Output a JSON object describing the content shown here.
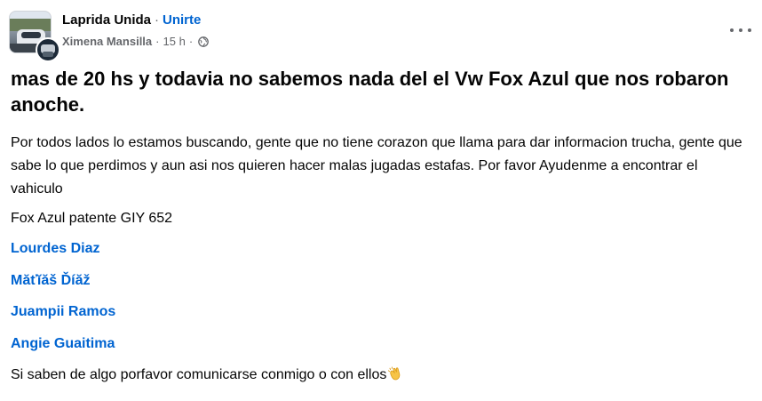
{
  "header": {
    "group_name": "Laprida Unida",
    "separator": "·",
    "join_label": "Unirte",
    "author": "Ximena Mansilla",
    "time_separator": "·",
    "timestamp": "15 h",
    "audience_icon": "globe-icon",
    "more_icon": "more-options-icon"
  },
  "post": {
    "title": "mas de 20 hs y todavia no sabemos nada del el Vw Fox Azul que nos robaron anoche.",
    "paragraph1": "Por todos lados lo estamos buscando, gente que no tiene corazon que llama para dar informacion trucha, gente que sabe lo que perdimos y aun asi nos quieren hacer malas jugadas estafas. Por favor Ayudenme a encontrar el vahiculo",
    "paragraph2": "Fox Azul patente GIY 652",
    "mentions": [
      "Lourdes Diaz",
      "Măťĭăš Ďíăž",
      "Juampii Ramos",
      "Angie Guaitima"
    ],
    "closing": "Si saben de algo porfavor comunicarse conmigo o con ellos",
    "closing_emoji": "clapping-hands-icon"
  },
  "colors": {
    "link": "#0064d1",
    "meta": "#65676b",
    "text": "#050505"
  }
}
